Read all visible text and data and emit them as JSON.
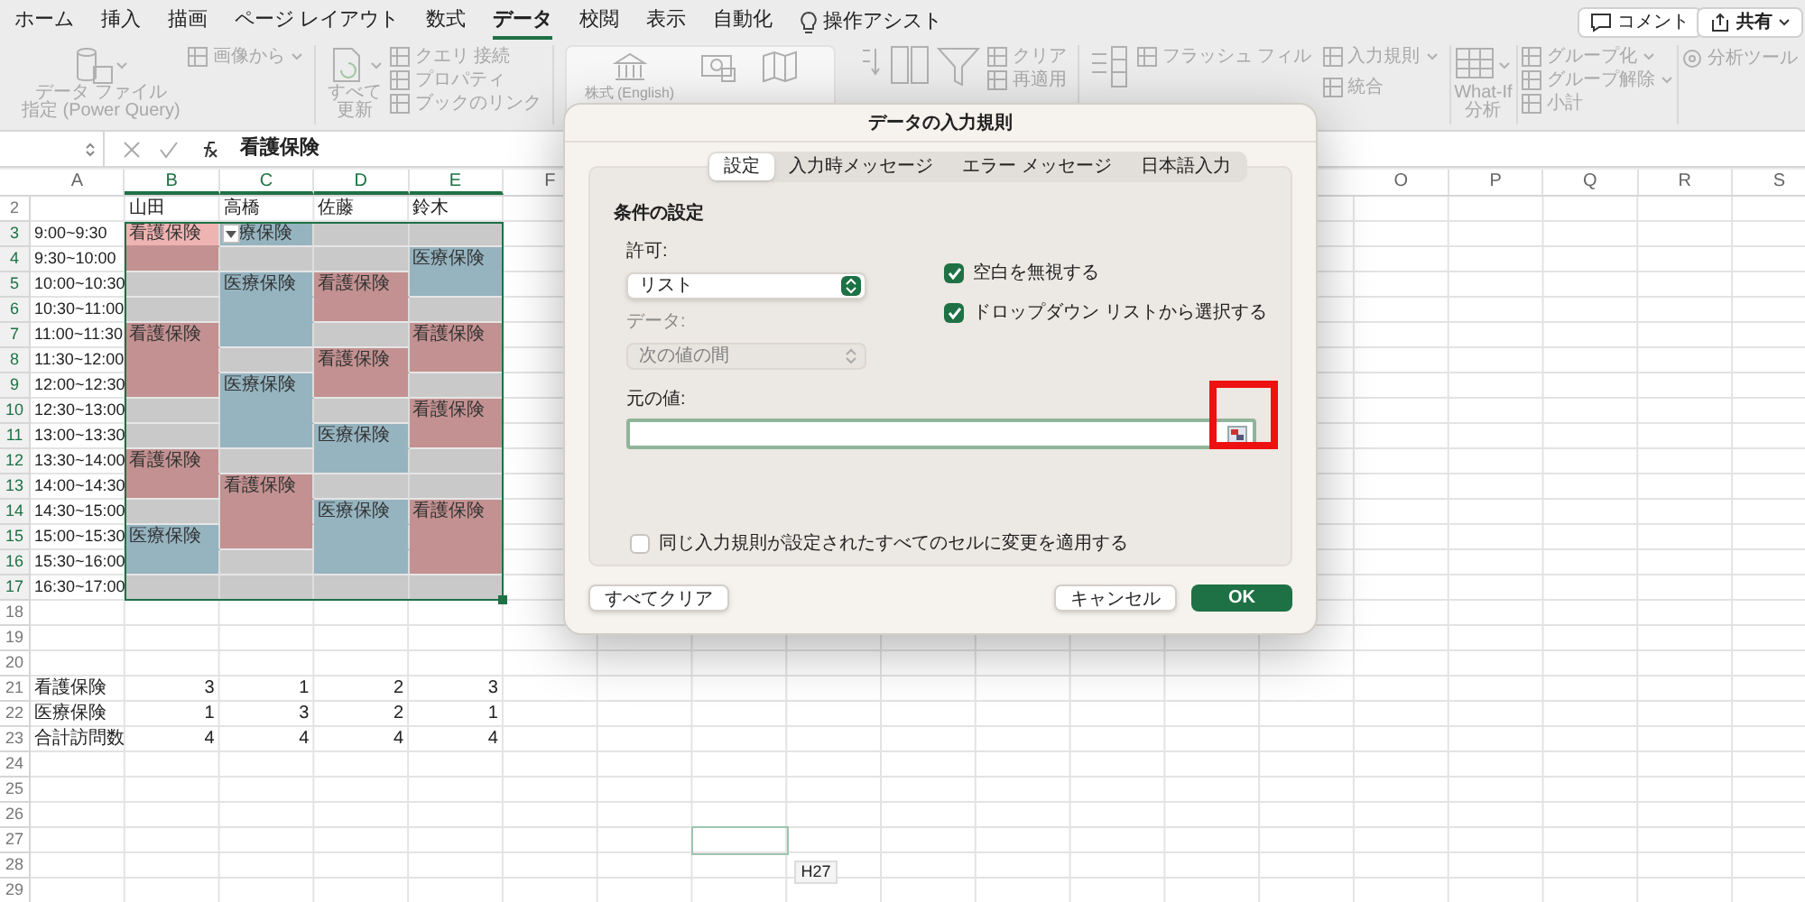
{
  "menu_tabs": [
    {
      "label": "ホーム",
      "selected": false
    },
    {
      "label": "挿入",
      "selected": false
    },
    {
      "label": "描画",
      "selected": false
    },
    {
      "label": "ページ レイアウト",
      "selected": false
    },
    {
      "label": "数式",
      "selected": false
    },
    {
      "label": "データ",
      "selected": true
    },
    {
      "label": "校閲",
      "selected": false
    },
    {
      "label": "表示",
      "selected": false
    },
    {
      "label": "自動化",
      "selected": false
    }
  ],
  "assist": {
    "label": "操作アシスト"
  },
  "comment_button": {
    "label": "コメント"
  },
  "share_button": {
    "label": "共有"
  },
  "ribbon": {
    "get_data": {
      "lines": [
        "データ ファイル",
        "指定 (Power Query)"
      ]
    },
    "from_picture": {
      "label": "画像から"
    },
    "refresh": {
      "lines": [
        "すべて",
        "更新"
      ]
    },
    "queries": [
      "クエリ 接続",
      "プロパティ",
      "ブックのリンク"
    ],
    "data_types": {
      "label": "株式 (English)"
    },
    "filter_small": [
      "クリア",
      "再適用"
    ],
    "tools": [
      "フラッシュ フィル",
      "入力規則",
      "統合"
    ],
    "what_if": {
      "lines": [
        "What-If",
        "分析"
      ]
    },
    "outline": [
      "グループ化",
      "グループ解除",
      "小計"
    ],
    "analysis": {
      "label": "分析ツール"
    }
  },
  "formula_bar": {
    "formula": "看護保険"
  },
  "sheet": {
    "columns_left": [
      {
        "label": "A",
        "selected": false
      },
      {
        "label": "B",
        "selected": true
      },
      {
        "label": "C",
        "selected": true
      },
      {
        "label": "D",
        "selected": true
      },
      {
        "label": "E",
        "selected": true
      },
      {
        "label": "F",
        "selected": false
      }
    ],
    "columns_right": [
      {
        "label": "O",
        "selected": false
      },
      {
        "label": "P",
        "selected": false
      },
      {
        "label": "Q",
        "selected": false
      },
      {
        "label": "R",
        "selected": false
      },
      {
        "label": "S",
        "selected": false
      }
    ],
    "rows": [
      {
        "number": "2",
        "selected": false,
        "outlined": false,
        "names": [
          "山田",
          "高橋",
          "佐藤",
          "鈴木"
        ]
      },
      {
        "number": "3",
        "selected": true,
        "outlined": false,
        "time": "9:00~9:30",
        "slots": [
          {
            "kind": "nursing",
            "text": "看護保険",
            "selected": true
          },
          {
            "kind": "medical",
            "text": "療保険",
            "selected": false
          },
          {
            "kind": "empty",
            "selected": false
          },
          {
            "kind": "empty",
            "selected": false
          }
        ]
      },
      {
        "number": "4",
        "selected": true,
        "outlined": false,
        "time": "9:30~10:00",
        "slots": [
          {
            "kind": "nursing",
            "selected": false
          },
          {
            "kind": "empty",
            "selected": false
          },
          {
            "kind": "empty",
            "selected": false
          },
          {
            "kind": "medical",
            "text": "医療保険",
            "selected": false
          }
        ]
      },
      {
        "number": "5",
        "selected": true,
        "outlined": false,
        "time": "10:00~10:30",
        "slots": [
          {
            "kind": "empty",
            "selected": false
          },
          {
            "kind": "medical",
            "text": "医療保険",
            "selected": false
          },
          {
            "kind": "nursing",
            "text": "看護保険",
            "selected": false
          },
          {
            "kind": "medical",
            "selected": false
          }
        ]
      },
      {
        "number": "6",
        "selected": true,
        "outlined": false,
        "time": "10:30~11:00",
        "slots": [
          {
            "kind": "empty",
            "selected": false
          },
          {
            "kind": "medical",
            "selected": false
          },
          {
            "kind": "nursing",
            "selected": false
          },
          {
            "kind": "empty",
            "selected": false
          }
        ]
      },
      {
        "number": "7",
        "selected": true,
        "outlined": false,
        "time": "11:00~11:30",
        "slots": [
          {
            "kind": "nursing",
            "text": "看護保険",
            "selected": false
          },
          {
            "kind": "medical",
            "selected": false
          },
          {
            "kind": "empty",
            "selected": false
          },
          {
            "kind": "nursing",
            "text": "看護保険",
            "selected": false
          }
        ]
      },
      {
        "number": "8",
        "selected": true,
        "outlined": false,
        "time": "11:30~12:00",
        "slots": [
          {
            "kind": "nursing",
            "selected": false
          },
          {
            "kind": "empty",
            "selected": false
          },
          {
            "kind": "nursing",
            "text": "看護保険",
            "selected": false
          },
          {
            "kind": "nursing",
            "selected": false
          }
        ]
      },
      {
        "number": "9",
        "selected": true,
        "outlined": false,
        "time": "12:00~12:30",
        "slots": [
          {
            "kind": "nursing",
            "selected": false
          },
          {
            "kind": "medical",
            "text": "医療保険",
            "selected": false
          },
          {
            "kind": "nursing",
            "selected": false
          },
          {
            "kind": "empty",
            "selected": false
          }
        ]
      },
      {
        "number": "10",
        "selected": true,
        "outlined": false,
        "time": "12:30~13:00",
        "slots": [
          {
            "kind": "empty",
            "selected": false
          },
          {
            "kind": "medical",
            "selected": false
          },
          {
            "kind": "empty",
            "selected": false
          },
          {
            "kind": "nursing",
            "text": "看護保険",
            "selected": false
          }
        ]
      },
      {
        "number": "11",
        "selected": true,
        "outlined": false,
        "time": "13:00~13:30",
        "slots": [
          {
            "kind": "empty",
            "selected": false
          },
          {
            "kind": "medical",
            "selected": false
          },
          {
            "kind": "medical",
            "text": "医療保険",
            "selected": false
          },
          {
            "kind": "nursing",
            "selected": false
          }
        ]
      },
      {
        "number": "12",
        "selected": true,
        "outlined": false,
        "time": "13:30~14:00",
        "slots": [
          {
            "kind": "nursing",
            "text": "看護保険",
            "selected": false
          },
          {
            "kind": "empty",
            "selected": false
          },
          {
            "kind": "medical",
            "selected": false
          },
          {
            "kind": "empty",
            "selected": false
          }
        ]
      },
      {
        "number": "13",
        "selected": true,
        "outlined": false,
        "time": "14:00~14:30",
        "slots": [
          {
            "kind": "nursing",
            "selected": false
          },
          {
            "kind": "nursing",
            "text": "看護保険",
            "selected": false
          },
          {
            "kind": "empty",
            "selected": false
          },
          {
            "kind": "empty",
            "selected": false
          }
        ]
      },
      {
        "number": "14",
        "selected": true,
        "outlined": false,
        "time": "14:30~15:00",
        "slots": [
          {
            "kind": "empty",
            "selected": false
          },
          {
            "kind": "nursing",
            "selected": false
          },
          {
            "kind": "medical",
            "text": "医療保険",
            "selected": false
          },
          {
            "kind": "nursing",
            "text": "看護保険",
            "selected": false
          }
        ]
      },
      {
        "number": "15",
        "selected": true,
        "outlined": false,
        "time": "15:00~15:30",
        "slots": [
          {
            "kind": "medical",
            "text": "医療保険",
            "selected": false
          },
          {
            "kind": "nursing",
            "selected": false
          },
          {
            "kind": "medical",
            "selected": false
          },
          {
            "kind": "nursing",
            "selected": false
          }
        ]
      },
      {
        "number": "16",
        "selected": true,
        "outlined": false,
        "time": "15:30~16:00",
        "slots": [
          {
            "kind": "medical",
            "selected": false
          },
          {
            "kind": "empty",
            "selected": false
          },
          {
            "kind": "medical",
            "selected": false
          },
          {
            "kind": "nursing",
            "selected": false
          }
        ]
      },
      {
        "number": "17",
        "selected": true,
        "outlined": false,
        "time": "16:30~17:00",
        "slots": [
          {
            "kind": "empty",
            "selected": false
          },
          {
            "kind": "empty",
            "selected": false
          },
          {
            "kind": "empty",
            "selected": false
          },
          {
            "kind": "empty",
            "selected": false
          }
        ]
      },
      {
        "number": "18",
        "selected": false,
        "outlined": false
      },
      {
        "number": "19",
        "selected": false,
        "outlined": false
      },
      {
        "number": "20",
        "selected": false,
        "outlined": false
      },
      {
        "number": "21",
        "selected": false,
        "outlined": false,
        "label": "看護保険",
        "values": [
          "3",
          "1",
          "2",
          "3"
        ]
      },
      {
        "number": "22",
        "selected": false,
        "outlined": false,
        "label": "医療保険",
        "values": [
          "1",
          "3",
          "2",
          "1"
        ]
      },
      {
        "number": "23",
        "selected": false,
        "outlined": false,
        "label": "合計訪問数",
        "values": [
          "4",
          "4",
          "4",
          "4"
        ]
      },
      {
        "number": "24",
        "selected": false,
        "outlined": false
      },
      {
        "number": "25",
        "selected": false,
        "outlined": false
      },
      {
        "number": "26",
        "selected": false,
        "outlined": false
      },
      {
        "number": "27",
        "selected": false,
        "outlined": true
      },
      {
        "number": "28",
        "selected": false,
        "outlined": false
      },
      {
        "number": "29",
        "selected": false,
        "outlined": false
      }
    ],
    "cell_tooltip": "H27"
  },
  "dialog": {
    "title": "データの入力規則",
    "tabs": [
      {
        "label": "設定",
        "selected": true
      },
      {
        "label": "入力時メッセージ",
        "selected": false
      },
      {
        "label": "エラー メッセージ",
        "selected": false
      },
      {
        "label": "日本語入力",
        "selected": false
      }
    ],
    "section_title": "条件の設定",
    "allow": {
      "label": "許可:",
      "value": "リスト",
      "disabled": false
    },
    "data": {
      "label": "データ:",
      "value": "次の値の間",
      "disabled": true
    },
    "options": [
      {
        "label": "空白を無視する",
        "checked": true
      },
      {
        "label": "ドロップダウン リストから選択する",
        "checked": true
      }
    ],
    "source": {
      "label": "元の値:"
    },
    "apply_all": {
      "label": "同じ入力規則が設定されたすべてのセルに変更を適用する",
      "checked": false
    },
    "buttons": [
      {
        "kind": "plain",
        "label": "すべてクリア"
      },
      {
        "kind": "plain",
        "label": "キャンセル"
      },
      {
        "kind": "primary",
        "label": "OK"
      }
    ]
  }
}
